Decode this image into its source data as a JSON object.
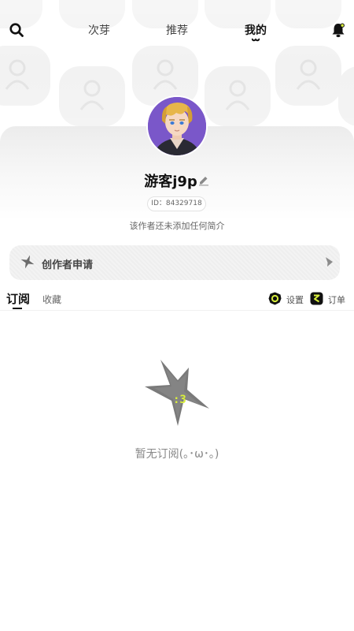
{
  "nav": {
    "tabs": [
      {
        "label": "次芽"
      },
      {
        "label": "推荐"
      },
      {
        "label": "我的"
      }
    ],
    "active_tab": "我的",
    "icons": {
      "search": "search-icon",
      "notification": "bell-icon"
    }
  },
  "profile": {
    "username": "游客j9p",
    "uid": "ID：84329718",
    "bio": "该作者还未添加任何简介"
  },
  "creator": {
    "label": "创作者申请"
  },
  "subtabs": {
    "items": [
      {
        "label": "订阅"
      },
      {
        "label": "收藏"
      }
    ],
    "active": "订阅"
  },
  "actions": {
    "settings_label": "设置",
    "orders_label": "订单"
  },
  "empty": {
    "message": "暂无订阅(｡･ω･｡)",
    "face": ":3"
  },
  "colors": {
    "accent": "#d9ef3c",
    "text_dark": "#111111",
    "text_muted": "#888888"
  }
}
